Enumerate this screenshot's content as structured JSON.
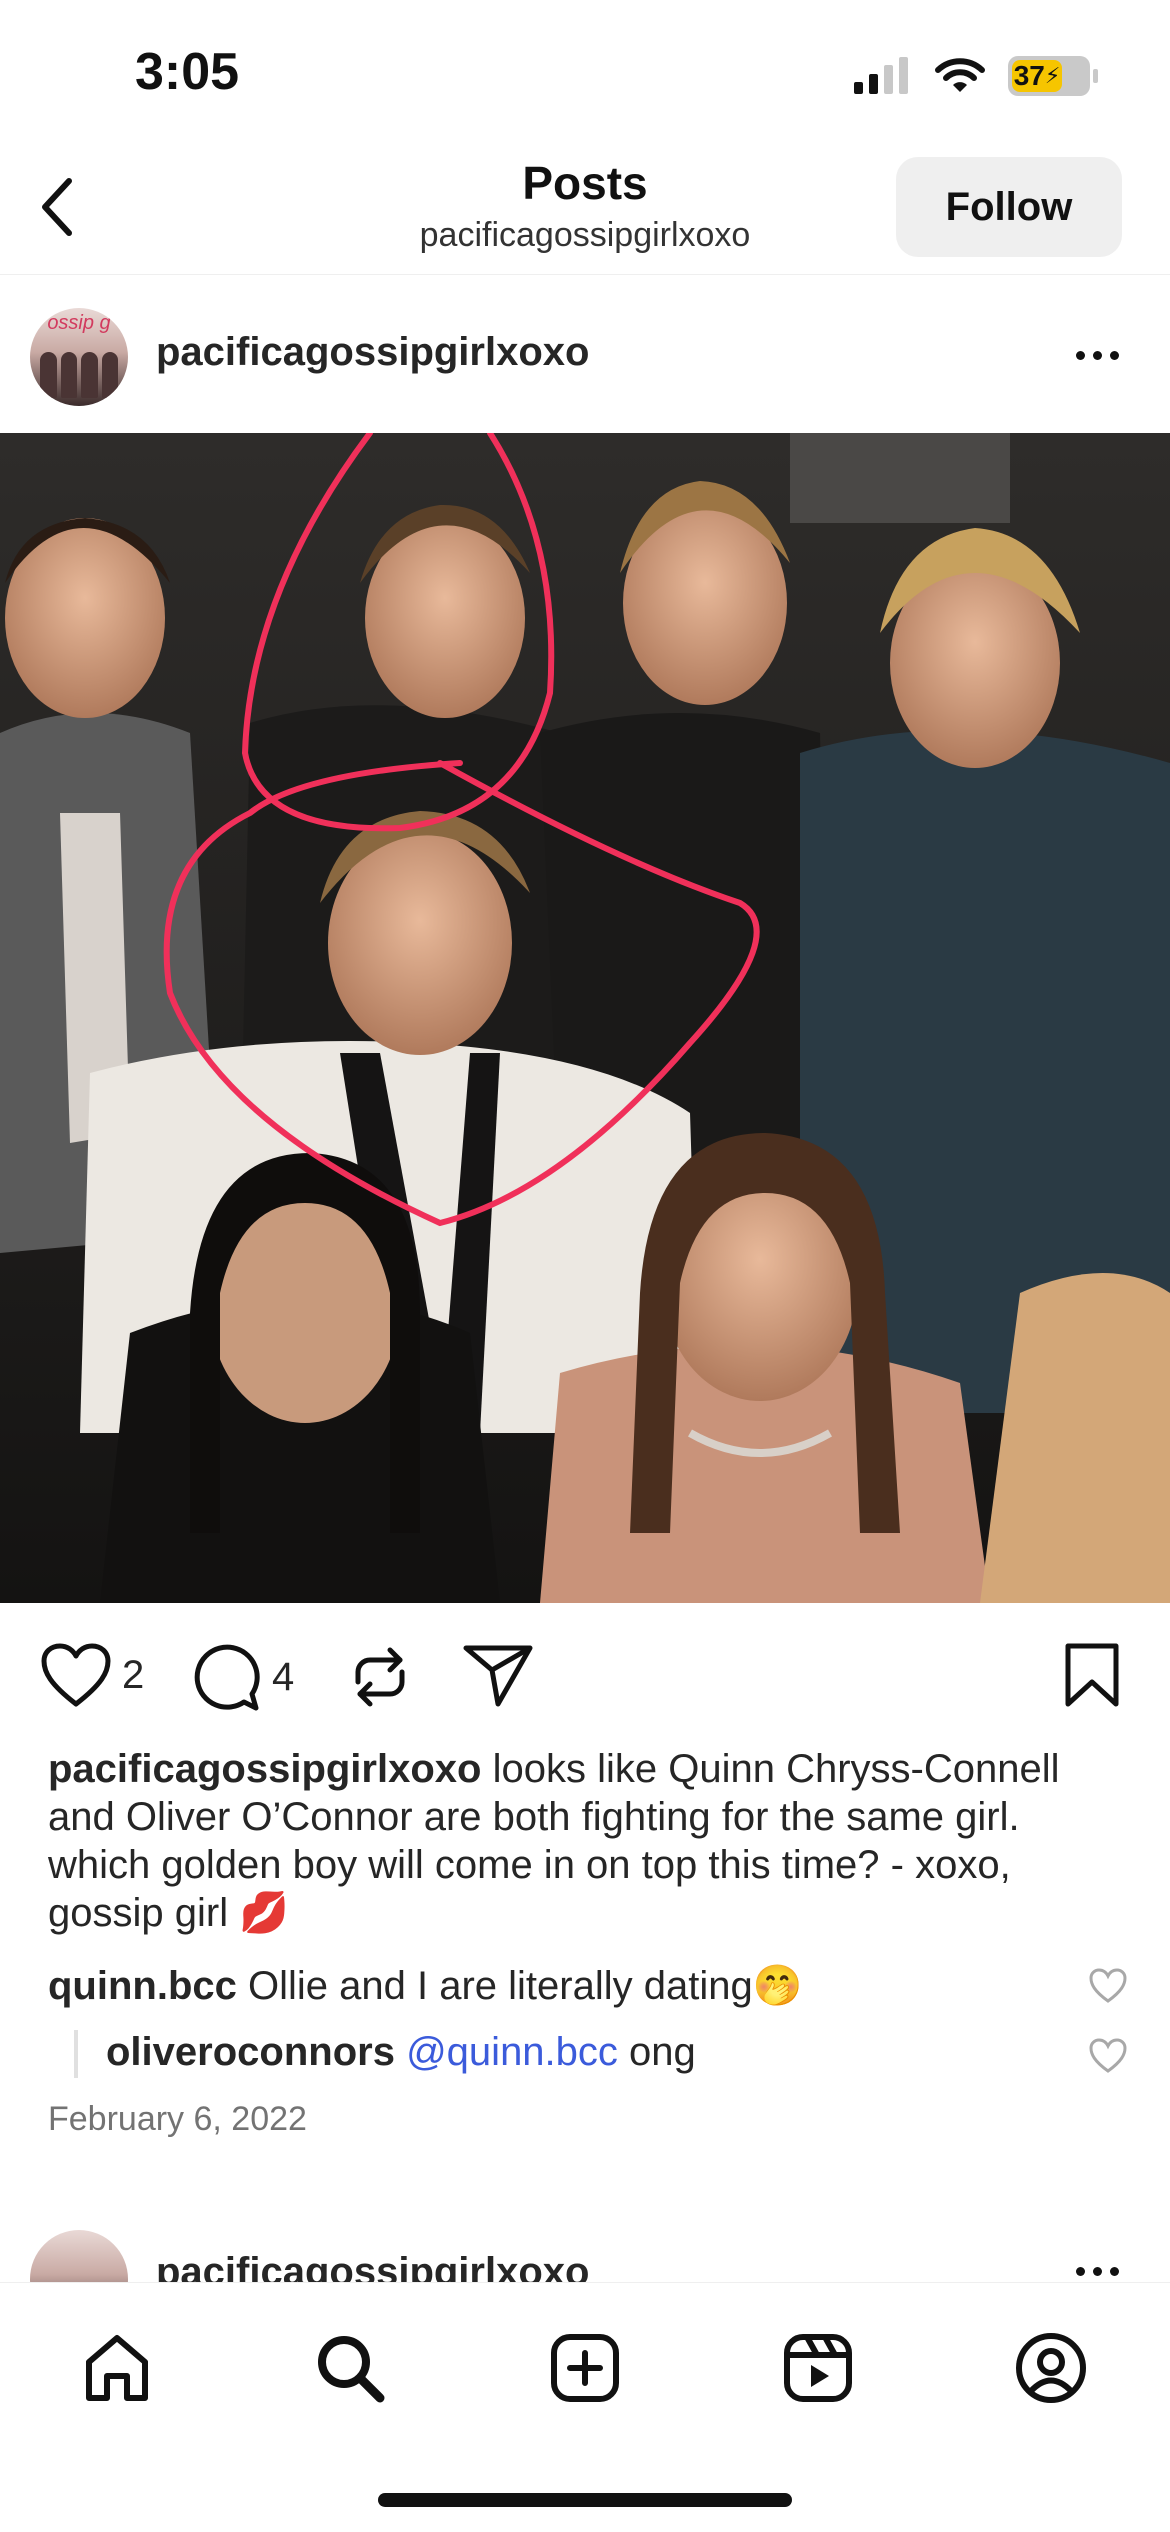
{
  "status_bar": {
    "time": "3:05",
    "battery": "37"
  },
  "header": {
    "title": "Posts",
    "subtitle": "pacificagossipgirlxoxo",
    "follow_label": "Follow"
  },
  "post": {
    "username": "pacificagossipgirlxoxo",
    "avatar_text": "ossip g",
    "likes": "2",
    "comments": "4",
    "caption_user": "pacificagossipgirlxoxo",
    "caption_text": "looks like Quinn Chryss-Connell and Oliver O’Connor are both fighting for the same girl.  which golden boy will come in on top this time? - xoxo, gossip girl 💋",
    "top_comments": [
      {
        "user": "quinn.bcc",
        "text": "Ollie and I are literally dating🤭"
      }
    ],
    "reply": {
      "user": "oliveroconnors",
      "mention": "@quinn.bcc",
      "text": "ong"
    },
    "date": "February 6, 2022"
  },
  "next_post": {
    "username": "pacificagossipgirlxoxo"
  },
  "tab_bar": [
    "home-icon",
    "search-icon",
    "create-icon",
    "reels-icon",
    "profile-icon"
  ],
  "colors": {
    "annotation_stroke": "#f0305a",
    "mention": "#3b5bdb",
    "battery": "#f6c500"
  }
}
